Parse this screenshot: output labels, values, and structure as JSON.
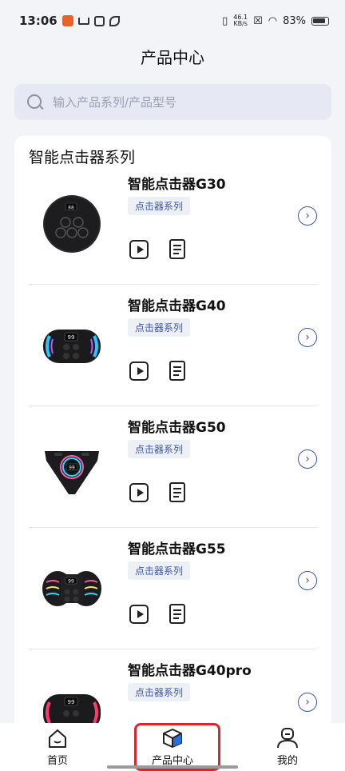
{
  "status_bar": {
    "time": "13:06",
    "net_speed_value": "46.1",
    "net_speed_unit": "KB/s",
    "battery": "83%"
  },
  "header": {
    "title": "产品中心"
  },
  "search": {
    "placeholder": "输入产品系列/产品型号"
  },
  "section": {
    "title": "智能点击器系列"
  },
  "products": [
    {
      "name": "智能点击器G30",
      "tag": "点击器系列"
    },
    {
      "name": "智能点击器G40",
      "tag": "点击器系列"
    },
    {
      "name": "智能点击器G50",
      "tag": "点击器系列"
    },
    {
      "name": "智能点击器G55",
      "tag": "点击器系列"
    },
    {
      "name": "智能点击器G40pro",
      "tag": "点击器系列"
    }
  ],
  "bottom_nav": {
    "items": [
      {
        "label": "首页",
        "icon": "home-icon"
      },
      {
        "label": "产品中心",
        "icon": "cube-icon",
        "active": true
      },
      {
        "label": "我的",
        "icon": "user-icon"
      }
    ]
  },
  "colors": {
    "accent": "#3b56a8",
    "highlight": "#d8272f",
    "cube": "#2a6de2"
  }
}
